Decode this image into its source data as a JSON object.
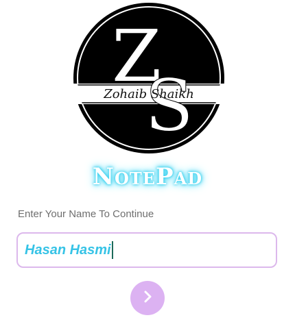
{
  "logo": {
    "monogram_top": "Z",
    "monogram_bottom": "S",
    "signature": "Zohaib Shaikh",
    "icon": "zs-logo-icon"
  },
  "app": {
    "title": "NotePad",
    "title_glow_color": "#35d0ef"
  },
  "form": {
    "prompt": "Enter Your Name To Continue",
    "name_value": "Hasan Hasmi",
    "value_color": "#36c3e6",
    "border_color": "#dcb8ec"
  },
  "actions": {
    "continue_icon": "chevron-right-icon",
    "button_color": "#dcb2f2"
  }
}
